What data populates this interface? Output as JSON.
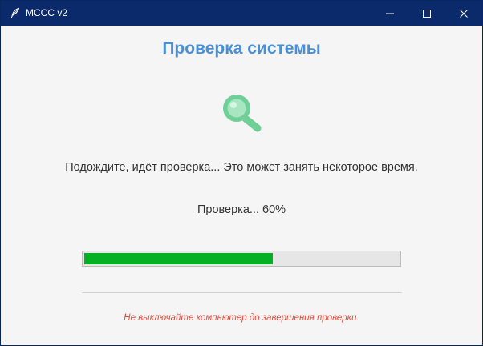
{
  "window": {
    "title": "МССС v2",
    "titlebar_color": "#0b2a6b",
    "app_icon": "feather-icon",
    "controls": {
      "minimize_icon": "minimize-icon",
      "maximize_icon": "maximize-icon",
      "close_icon": "close-icon"
    }
  },
  "main": {
    "heading": "Проверка системы",
    "heading_color": "#4a90d9",
    "icon": "search-icon",
    "icon_color": "#6fcf97",
    "message": "Подождите, идёт проверка... Это может занять некоторое время.",
    "status": "Проверка... 60%",
    "progress": {
      "value": 0.6,
      "fill_color": "#06b025"
    },
    "warning": "Не выключайте компьютер до завершения проверки.",
    "warning_color": "#e74c3c"
  }
}
